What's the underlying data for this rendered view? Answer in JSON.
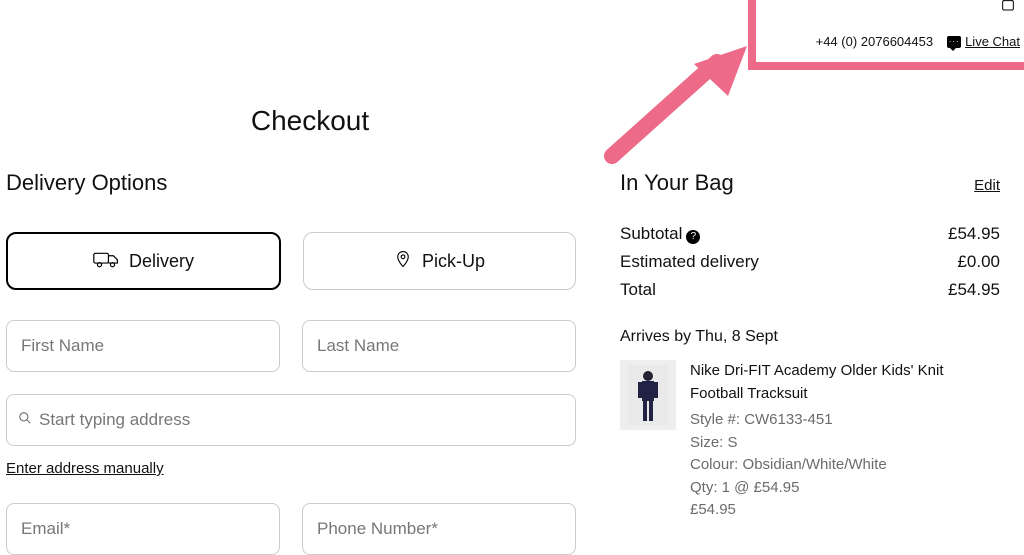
{
  "header": {
    "phone": "+44 (0) 2076604453",
    "live_chat": "Live Chat"
  },
  "page_title": "Checkout",
  "delivery": {
    "heading": "Delivery Options",
    "option_delivery": "Delivery",
    "option_pickup": "Pick-Up",
    "first_name_ph": "First Name",
    "last_name_ph": "Last Name",
    "address_ph": "Start typing address",
    "manual_link": "Enter address manually",
    "email_ph": "Email*",
    "phone_ph": "Phone Number*"
  },
  "bag": {
    "heading": "In Your Bag",
    "edit": "Edit",
    "subtotal_label": "Subtotal",
    "subtotal_value": "£54.95",
    "shipping_label": "Estimated delivery",
    "shipping_value": "£0.00",
    "total_label": "Total",
    "total_value": "£54.95",
    "arrives": "Arrives by Thu, 8 Sept",
    "item": {
      "name": "Nike Dri-FIT Academy Older Kids' Knit Football Tracksuit",
      "style": "Style #: CW6133-451",
      "size": "Size: S",
      "colour": "Colour: Obsidian/White/White",
      "qty": "Qty: 1 @ £54.95",
      "price": "£54.95"
    }
  }
}
